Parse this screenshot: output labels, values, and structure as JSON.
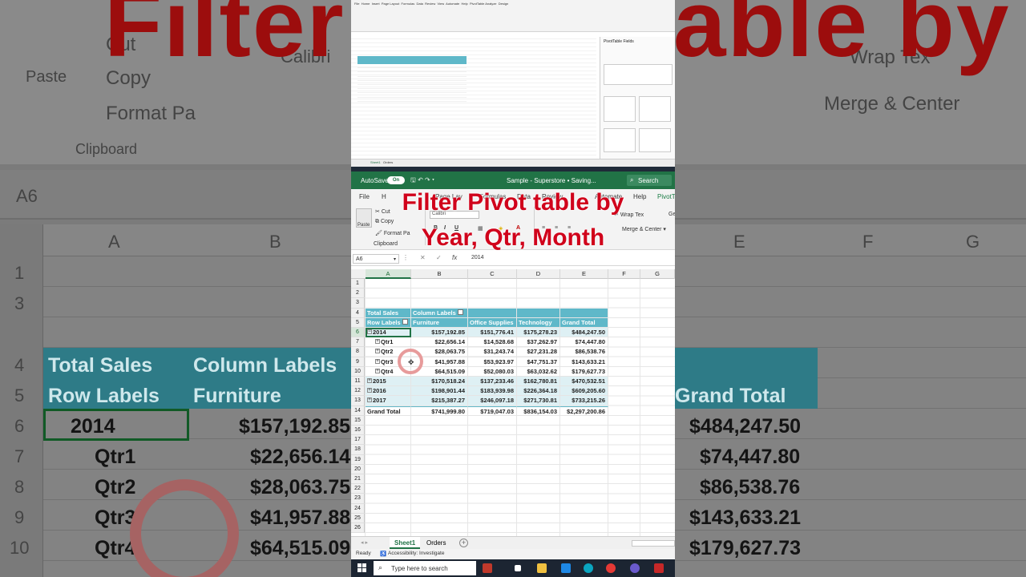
{
  "background": {
    "overlay_title": "Filter Pivot table by Year, Qtr, Month",
    "ribbon": {
      "paste": "Paste",
      "cut": "Cut",
      "copy": "Copy",
      "format_painter": "Format Pa",
      "clipboard": "Clipboard",
      "font": "Calibri",
      "wrap_text": "Wrap Tex",
      "merge_center": "Merge & Center"
    },
    "name_box": "A6",
    "columns": [
      "A",
      "B",
      "E",
      "F",
      "G"
    ],
    "rows": [
      "1",
      "3",
      "4",
      "5",
      "6",
      "7",
      "8",
      "9",
      "10"
    ],
    "pivot": {
      "total_sales": "Total Sales",
      "column_labels": "Column Labels",
      "row_labels": "Row Labels",
      "furniture": "Furniture",
      "grand_total": "Grand Total",
      "year_2014": "2014",
      "qtrs": [
        "Qtr1",
        "Qtr2",
        "Qtr3",
        "Qtr4"
      ],
      "col_b": [
        "$157,192.85",
        "$22,656.14",
        "$28,063.75",
        "$41,957.88",
        "$64,515.09"
      ],
      "col_e": [
        "$484,247.50",
        "$74,447.80",
        "$86,538.76",
        "$143,633.21",
        "$179,627.73"
      ]
    }
  },
  "preview": {
    "tabs": [
      "File",
      "Home",
      "Insert",
      "Page Layout",
      "Formulas",
      "Data",
      "Review",
      "View",
      "Automate",
      "Help",
      "PivotTable Analyze",
      "Design"
    ],
    "pane_title": "PivotTable Fields",
    "sheet_tabs": [
      "Sheet1",
      "Orders"
    ]
  },
  "titlebar": {
    "autosave": "AutoSave",
    "toggle": "On",
    "doc_title": "Sample - Superstore • Saving...",
    "search": "Search"
  },
  "menu_tabs": [
    "File",
    "H",
    "Page Lay",
    "Formulas",
    "Data",
    "Review",
    "Automate",
    "Help",
    "PivotT"
  ],
  "ribbon": {
    "paste": "Paste",
    "cut": "Cut",
    "copy": "Copy",
    "format_painter": "Format Pa",
    "clipboard": "Clipboard",
    "font": "Calibri",
    "bold": "B",
    "italic": "I",
    "underline": "U",
    "wrap_text": "Wrap Tex",
    "merge_center": "Merge & Center",
    "ge": "Ge"
  },
  "overlay_title_line1": "Filter Pivot table by",
  "overlay_title_line2": "Year, Qtr, Month",
  "formula_bar": {
    "name_box": "A6",
    "cancel": "✕",
    "enter": "✓",
    "fx": "fx",
    "value": "2014"
  },
  "columns": [
    "A",
    "B",
    "C",
    "D",
    "E",
    "F",
    "G"
  ],
  "rows": [
    "1",
    "2",
    "3",
    "4",
    "5",
    "6",
    "7",
    "8",
    "9",
    "10",
    "11",
    "12",
    "13",
    "14",
    "15",
    "16",
    "17",
    "18",
    "19",
    "20",
    "21",
    "22",
    "23",
    "24",
    "25",
    "26"
  ],
  "pivot": {
    "total_sales": "Total Sales",
    "column_labels": "Column Labels",
    "row_labels": "Row Labels",
    "headers": [
      "Furniture",
      "Office Supplies",
      "Technology",
      "Grand Total"
    ],
    "body": [
      {
        "label": "2014",
        "kind": "year",
        "expander": "−",
        "values": [
          "$157,192.85",
          "$151,776.41",
          "$175,278.23",
          "$484,247.50"
        ]
      },
      {
        "label": "Qtr1",
        "kind": "qtr",
        "expander": "+",
        "values": [
          "$22,656.14",
          "$14,528.68",
          "$37,262.97",
          "$74,447.80"
        ]
      },
      {
        "label": "Qtr2",
        "kind": "qtr",
        "expander": "+",
        "values": [
          "$28,063.75",
          "$31,243.74",
          "$27,231.28",
          "$86,538.76"
        ]
      },
      {
        "label": "Qtr3",
        "kind": "qtr",
        "expander": "+",
        "values": [
          "$41,957.88",
          "$53,923.97",
          "$47,751.37",
          "$143,633.21"
        ]
      },
      {
        "label": "Qtr4",
        "kind": "qtr",
        "expander": "+",
        "values": [
          "$64,515.09",
          "$52,080.03",
          "$63,032.62",
          "$179,627.73"
        ]
      },
      {
        "label": "2015",
        "kind": "year",
        "expander": "+",
        "values": [
          "$170,518.24",
          "$137,233.46",
          "$162,780.81",
          "$470,532.51"
        ]
      },
      {
        "label": "2016",
        "kind": "year",
        "expander": "+",
        "values": [
          "$198,901.44",
          "$183,939.98",
          "$226,364.18",
          "$609,205.60"
        ]
      },
      {
        "label": "2017",
        "kind": "year",
        "expander": "+",
        "values": [
          "$215,387.27",
          "$246,097.18",
          "$271,730.81",
          "$733,215.26"
        ]
      }
    ],
    "grand_total": {
      "label": "Grand Total",
      "values": [
        "$741,999.80",
        "$719,047.03",
        "$836,154.03",
        "$2,297,200.86"
      ]
    }
  },
  "sheet_tabs": [
    "Sheet1",
    "Orders"
  ],
  "add_sheet": "+",
  "status": {
    "ready": "Ready",
    "accessibility": "Accessibility: Investigate"
  },
  "taskbar": {
    "search_placeholder": "Type here to search"
  },
  "colors": {
    "excel_green": "#217346",
    "pivot_header": "#5fb8c9",
    "overlay_red": "#d0021b"
  }
}
